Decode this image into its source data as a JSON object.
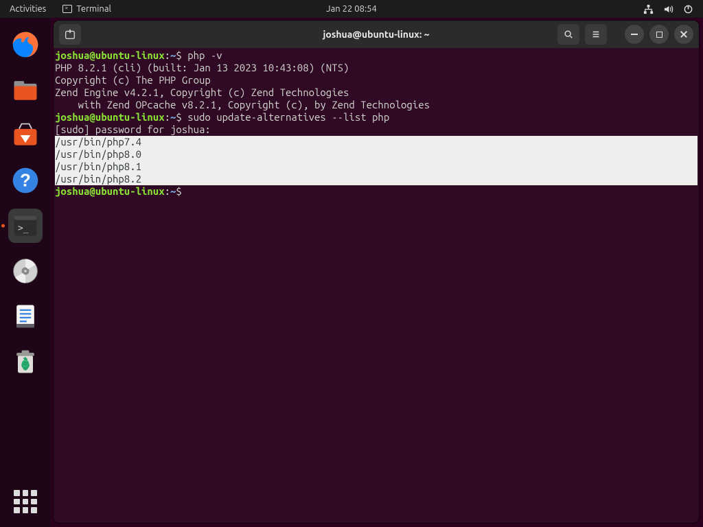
{
  "topbar": {
    "activities": "Activities",
    "app_label": "Terminal",
    "clock": "Jan 22  08:54"
  },
  "window": {
    "title": "joshua@ubuntu-linux: ~"
  },
  "prompt": {
    "user": "joshua@ubuntu-linux",
    "sep": ":",
    "path": "~",
    "sigil": "$"
  },
  "session": {
    "cmd1": "php -v",
    "out1": "PHP 8.2.1 (cli) (built: Jan 13 2023 10:43:08) (NTS)",
    "out2": "Copyright (c) The PHP Group",
    "out3": "Zend Engine v4.2.1, Copyright (c) Zend Technologies",
    "out4": "    with Zend OPcache v8.2.1, Copyright (c), by Zend Technologies",
    "cmd2": "sudo update-alternatives --list php",
    "out5": "[sudo] password for joshua:",
    "hl1": "/usr/bin/php7.4",
    "hl2": "/usr/bin/php8.0",
    "hl3": "/usr/bin/php8.1",
    "hl4": "/usr/bin/php8.2"
  },
  "dock": {
    "items": [
      "firefox",
      "files",
      "software",
      "help",
      "terminal",
      "disk",
      "texteditor",
      "trash"
    ],
    "active": "terminal"
  },
  "colors": {
    "accent": "#e95420",
    "term_bg": "#300a24",
    "prompt_user": "#8ae234",
    "prompt_path": "#729fcf"
  }
}
